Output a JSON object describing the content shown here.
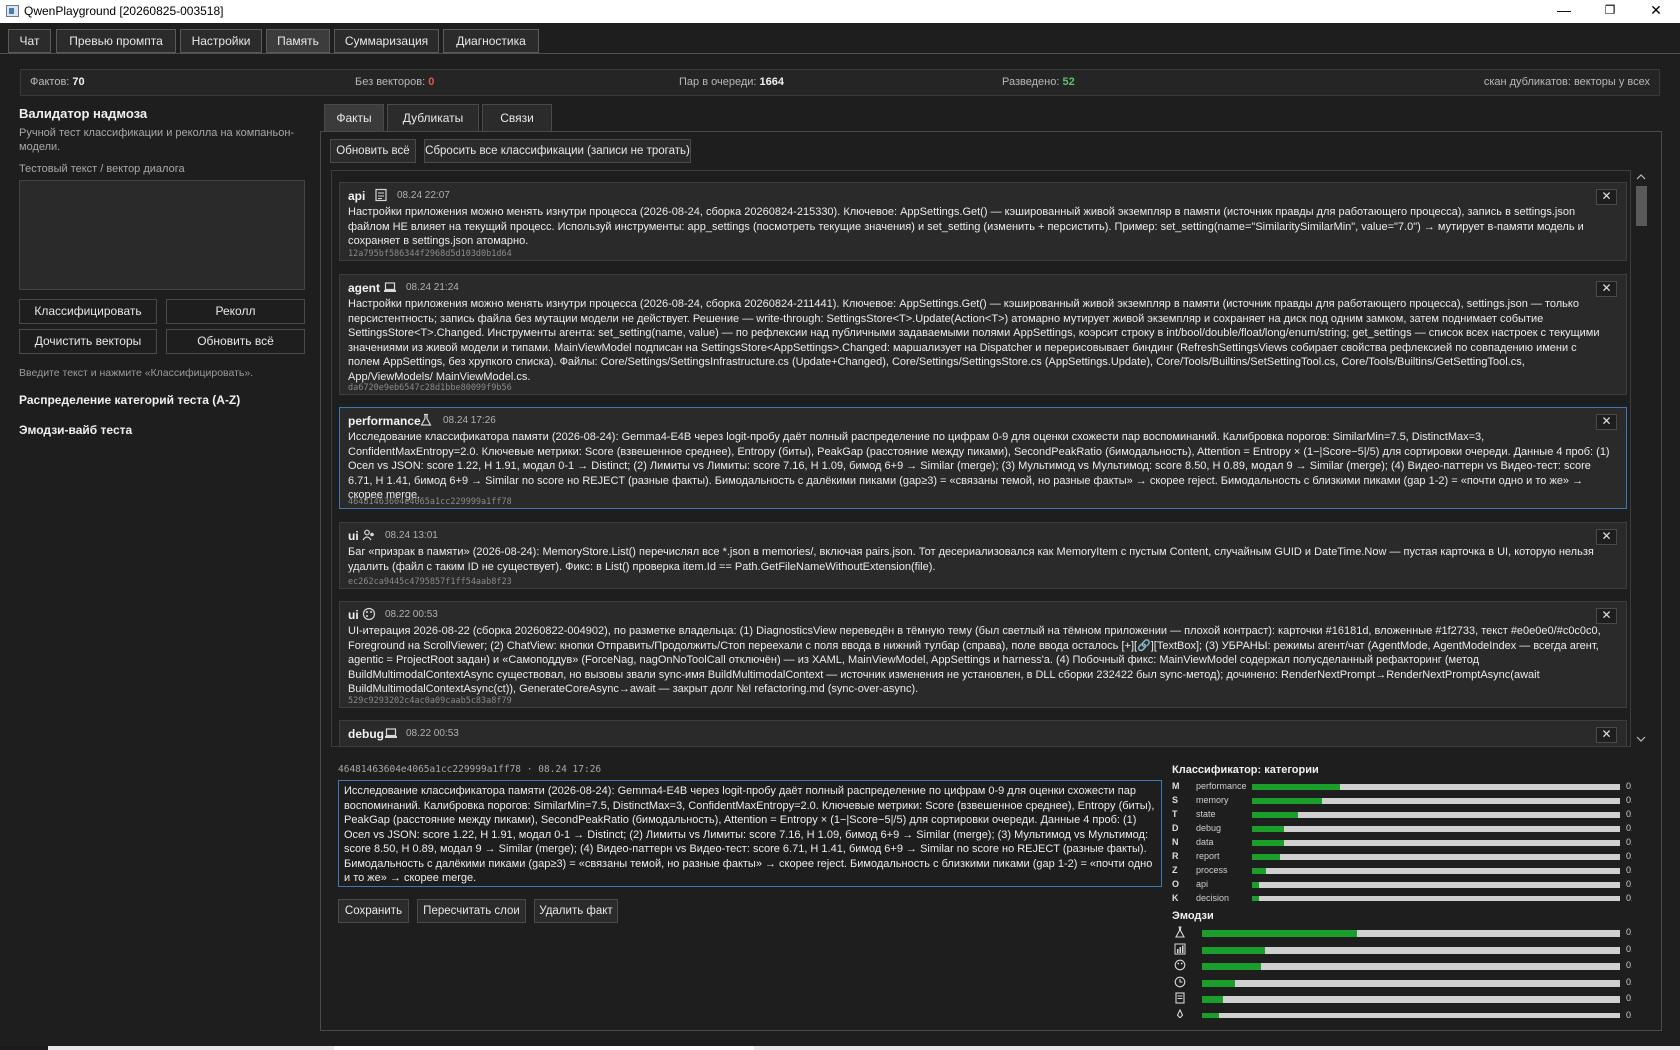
{
  "window": {
    "title": "QwenPlayground [20260825-003518]",
    "minimize": "—",
    "maximize": "❐",
    "close": "✕"
  },
  "tabs": [
    "Чат",
    "Превью промпта",
    "Настройки",
    "Память",
    "Суммаризация",
    "Диагностика"
  ],
  "stats": {
    "facts_label": "Фактов:",
    "facts": "70",
    "novec_label": "Без векторов:",
    "novec": "0",
    "queue_label": "Пар в очереди:",
    "queue": "1664",
    "split_label": "Разведено:",
    "split": "52",
    "scan": "скан дубликатов: векторы у всех",
    "colors": {
      "novec": "#e05a4a",
      "split": "#5fbf6a"
    }
  },
  "left": {
    "title": "Валидатор надмоза",
    "subtitle": "Ручной тест классификации и реколла на компаньон-модели.",
    "input_label": "Тестовый текст / вектор диалога",
    "btn_classify": "Классифицировать",
    "btn_recall": "Реколл",
    "btn_clean": "Дочистить векторы",
    "btn_refresh": "Обновить всё",
    "hint": "Введите текст и нажмите «Классифицировать».",
    "section1": "Распределение категорий теста (A-Z)",
    "section2": "Эмодзи-вайб теста"
  },
  "subtabs": [
    "Факты",
    "Дубликаты",
    "Связи"
  ],
  "toolbar": {
    "refresh": "Обновить всё",
    "reset": "Сбросить все классификации (записи не трогать)"
  },
  "cards": [
    {
      "cat": "api",
      "icon": "document-icon",
      "date": "08.24 22:07",
      "text": "Настройки приложения можно менять изнутри процесса (2026-08-24, сборка 20260824-215330). Ключевое: AppSettings.Get() — кэшированный живой экземпляр в памяти (источник правды для работающего процесса), запись в settings.json файлом НЕ влияет на текущий процесс. Используй инструменты: app_settings (посмотреть текущие значения) и set_setting (изменить + персистить). Пример: set_setting(name=\"SimilaritySimilarMin\", value=\"7.0\") → мутирует в-памяти модель и сохраняет в settings.json атомарно.",
      "hash": "12a795bf586344f2968d5d103d0b1d64"
    },
    {
      "cat": "agent",
      "icon": "laptop-icon",
      "date": "08.24 21:24",
      "text": "Настройки приложения можно менять изнутри процесса (2026-08-24, сборка 20260824-211441). Ключевое: AppSettings.Get() — кэшированный живой экземпляр в памяти (источник правды для работающего процесса), settings.json — только персистентность; запись файла без мутации модели не действует. Решение — write-through: SettingsStore<T>.Update(Action<T>) атомарно мутирует живой экземпляр и сохраняет на диск под одним замком, затем поднимает событие SettingsStore<T>.Changed. Инструменты агента: set_setting(name, value) — по рефлексии над публичными задаваемыми полями AppSettings, коэрсит строку в int/bool/double/float/long/enum/string; get_settings — список всех настроек с текущими значениями из живой модели и типами. MainViewModel подписан на SettingsStore<AppSettings>.Changed: маршализует на Dispatcher и перерисовывает биндинг (RefreshSettingsViews собирает свойства рефлексией по совпадению имени с полем AppSettings, без хрупкого списка). Файлы: Core/Settings/SettingsInfrastructure.cs (Update+Changed), Core/Settings/SettingsStore.cs (AppSettings.Update), Core/Tools/Builtins/SetSettingTool.cs, Core/Tools/Builtins/GetSettingTool.cs, App/ViewModels/ MainViewModel.cs.",
      "hash": "da6720e9eb6547c28d1bbe80099f9b56"
    },
    {
      "cat": "performance",
      "icon": "flask-icon",
      "date": "08.24 17:26",
      "text": "Исследование классификатора памяти (2026-08-24): Gemma4-E4B через logit-пробу даёт полный распределение по цифрам 0-9 для оценки схожести пар воспоминаний. Калибровка порогов: SimilarMin=7.5, DistinctMax=3, ConfidentMaxEntropy=2.0. Ключевые метрики: Score (взвешенное среднее), Entropy (биты), PeakGap (расстояние между пиками), SecondPeakRatio (бимодальность), Attention = Entropy × (1−|Score−5|/5) для сортировки очереди. Данные 4 проб: (1) Осел vs JSON: score 1.22, H 1.91, модал 0-1 → Distinct; (2) Лимиты vs Лимиты: score 7.16, H 1.09, бимод 6+9 → Similar (merge); (3) Мультимод vs Мультимод: score 8.50, H 0.89, модал 9 → Similar (merge); (4) Видео-паттерн vs Видео-тест: score 6.71, H 1.41, бимод 6+9 → Similar no score но REJECT (разные факты). Бимодальность с далёкими пиками (gap≥3) = «связаны темой, но разные факты» → скорее reject. Бимодальность с близкими пиками (gap 1-2) = «почти одно и то же» → скорее merge.",
      "hash": "46481463604e4065a1cc229999a1ff78"
    },
    {
      "cat": "ui",
      "icon": "people-icon",
      "date": "08.24 13:01",
      "text": "Баг «призрак в памяти» (2026-08-24): MemoryStore.List() перечислял все *.json в memories/, включая pairs.json. Тот десериализовался как MemoryItem с пустым Content, случайным GUID и DateTime.Now — пустая карточка в UI, которую нельзя удалить (файл с таким ID не существует). Фикс: в List() проверка item.Id == Path.GetFileNameWithoutExtension(file).",
      "hash": "ec262ca9445c4795857f1ff54aab8f23"
    },
    {
      "cat": "ui",
      "icon": "palette-icon",
      "date": "08.22 00:53",
      "text": "UI-итерация 2026-08-22 (сборка 20260822-004902), по разметке владельца: (1) DiagnosticsView переведён в тёмную тему (был светлый на тёмном приложении — плохой контраст): карточки #16181d, вложенные #1f2733, текст #e0e0e0/#c0c0c0, Foreground на ScrollViewer; (2) ChatView: кнопки Отправить/Продолжить/Стоп переехали с поля ввода в нижний тулбар (справа), поле ввода осталось [+][🔗][TextBox]; (3) УБРАНЫ: режимы агент/чат (AgentMode, AgentModeIndex — всегда агент, agentic = ProjectRoot задан) и «Самоподдув» (ForceNag, nagOnNoToolCall отключён) — из XAML, MainViewModel, AppSettings и harness'а. (4) Побочный фикс: MainViewModel содержал полусделанный рефакторинг (метод BuildMultimodalContextAsync существовал, но вызовы звали sync-имя BuildMultimodalContext — источник изменения не установлен, в DLL сборки 232422 был sync-метод); дочинено: RenderNextPrompt→RenderNextPromptAsync(await BuildMultimodalContextAsync(ct)), GenerateCoreAsync→await — закрыт долг №I refactoring.md (sync-over-async).",
      "hash": "529c9293202c4ac0a09caab5c83a8f79"
    },
    {
      "cat": "debug",
      "icon": "laptop-icon",
      "date": "08.22 00:53",
      "text": "",
      "hash": ""
    }
  ],
  "card_close": "✕",
  "detail": {
    "hash": "46481463604e4065a1cc229999a1ff78",
    "sep": "·",
    "date": "08.24 17:26",
    "text": "Исследование классификатора памяти (2026-08-24): Gemma4-E4B через logit-пробу даёт полный распределение по цифрам 0-9 для оценки схожести пар воспоминаний. Калибровка порогов: SimilarMin=7.5, DistinctMax=3, ConfidentMaxEntropy=2.0. Ключевые метрики: Score (взвешенное среднее), Entropy (биты), PeakGap (расстояние между пиками), SecondPeakRatio (бимодальность), Attention = Entropy × (1−|Score−5|/5) для сортировки очереди. Данные 4 проб: (1) Осел vs JSON: score 1.22, H 1.91, модал 0-1 → Distinct; (2) Лимиты vs Лимиты: score 7.16, H 1.09, бимод 6+9 → Similar (merge); (3) Мультимод vs Мультимод: score 8.50, H 0.89, модал 9 → Similar (merge); (4) Видео-паттерн vs Видео-тест: score 6.71, H 1.41, бимод 6+9 → Similar no score но REJECT (разные факты). Бимодальность с далёкими пиками (gap≥3) = «связаны темой, но разные факты» → скорее reject. Бимодальность с близкими пиками (gap 1-2) = «почти одно и то же» → скорее merge.",
    "btn_save": "Сохранить",
    "btn_recalc": "Пересчитать слои",
    "btn_delete": "Удалить факт"
  },
  "classifier": {
    "title": "Классификатор: категории",
    "rows": [
      {
        "letter": "M",
        "name": "performance",
        "value": 0.25,
        "label": "0.25"
      },
      {
        "letter": "S",
        "name": "memory",
        "value": 0.2,
        "label": "0.20"
      },
      {
        "letter": "T",
        "name": "state",
        "value": 0.13,
        "label": "0.13"
      },
      {
        "letter": "D",
        "name": "debug",
        "value": 0.09,
        "label": "0.09"
      },
      {
        "letter": "N",
        "name": "data",
        "value": 0.09,
        "label": "0.09"
      },
      {
        "letter": "R",
        "name": "report",
        "value": 0.08,
        "label": "0.08"
      },
      {
        "letter": "Z",
        "name": "process",
        "value": 0.04,
        "label": "0.04"
      },
      {
        "letter": "O",
        "name": "api",
        "value": 0.02,
        "label": "0.02"
      },
      {
        "letter": "K",
        "name": "decision",
        "value": 0.02,
        "label": "0.02"
      }
    ]
  },
  "emoji": {
    "title": "Эмодзи",
    "rows": [
      {
        "icon": "flask-icon",
        "value": 0.37,
        "label": "0.37"
      },
      {
        "icon": "bar-chart-icon",
        "value": 0.15,
        "label": "0.15"
      },
      {
        "icon": "palette-icon",
        "value": 0.14,
        "label": "0.14"
      },
      {
        "icon": "clock-icon",
        "value": 0.08,
        "label": "0.08"
      },
      {
        "icon": "document-icon",
        "value": 0.05,
        "label": "0.05"
      },
      {
        "icon": "rocket-icon",
        "value": 0.04,
        "label": "0.04"
      }
    ]
  }
}
